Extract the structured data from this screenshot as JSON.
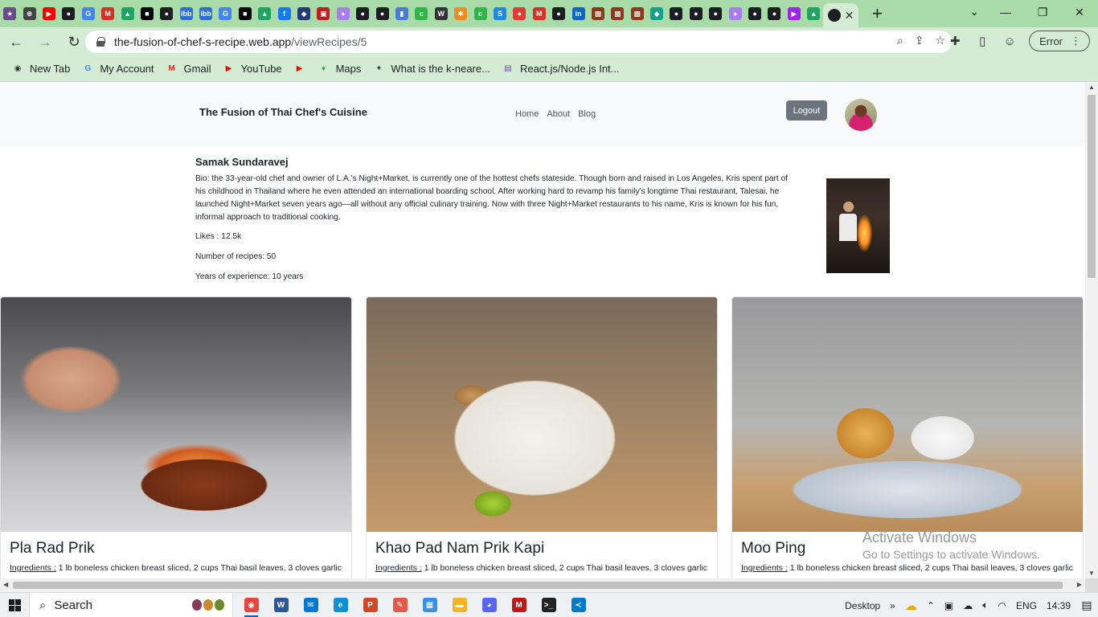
{
  "browser": {
    "tab_favicons": [
      {
        "name": "site-icon",
        "color": "#6b4c8a",
        "glyph": "★"
      },
      {
        "name": "openai-icon",
        "color": "#444",
        "glyph": "⊛"
      },
      {
        "name": "youtube-icon",
        "color": "#ff0000",
        "glyph": "▶"
      },
      {
        "name": "github-icon",
        "color": "#1b1f23",
        "glyph": "●"
      },
      {
        "name": "google-icon",
        "color": "#4285f4",
        "glyph": "G"
      },
      {
        "name": "gmail-icon",
        "color": "#d93025",
        "glyph": "M"
      },
      {
        "name": "drive-icon",
        "color": "#1fa463",
        "glyph": "▲"
      },
      {
        "name": "app-icon",
        "color": "#000",
        "glyph": "■"
      },
      {
        "name": "github-icon",
        "color": "#1b1f23",
        "glyph": "●"
      },
      {
        "name": "ibb-icon",
        "color": "#2a6ed8",
        "glyph": "ibb"
      },
      {
        "name": "ibb-icon",
        "color": "#2a6ed8",
        "glyph": "ibb"
      },
      {
        "name": "google-icon",
        "color": "#4285f4",
        "glyph": "G"
      },
      {
        "name": "app-icon",
        "color": "#000",
        "glyph": "■"
      },
      {
        "name": "drive-icon",
        "color": "#1fa463",
        "glyph": "▲"
      },
      {
        "name": "facebook-icon",
        "color": "#1877f2",
        "glyph": "f"
      },
      {
        "name": "site-icon",
        "color": "#223a7a",
        "glyph": "◆"
      },
      {
        "name": "site-icon",
        "color": "#c01e1e",
        "glyph": "▣"
      },
      {
        "name": "site-icon",
        "color": "#a97cf0",
        "glyph": "♦"
      },
      {
        "name": "github-icon",
        "color": "#1b1f23",
        "glyph": "●"
      },
      {
        "name": "github-icon",
        "color": "#1b1f23",
        "glyph": "●"
      },
      {
        "name": "site-icon",
        "color": "#4a7bd6",
        "glyph": "▮"
      },
      {
        "name": "site-icon",
        "color": "#2fb54a",
        "glyph": "c"
      },
      {
        "name": "site-icon",
        "color": "#333",
        "glyph": "W"
      },
      {
        "name": "site-icon",
        "color": "#f08a24",
        "glyph": "✱"
      },
      {
        "name": "site-icon",
        "color": "#2fb54a",
        "glyph": "c"
      },
      {
        "name": "site-icon",
        "color": "#1e88e5",
        "glyph": "S"
      },
      {
        "name": "site-icon",
        "color": "#e53935",
        "glyph": "●"
      },
      {
        "name": "gmail-icon",
        "color": "#d93025",
        "glyph": "M"
      },
      {
        "name": "github-icon",
        "color": "#1b1f23",
        "glyph": "●"
      },
      {
        "name": "linkedin-icon",
        "color": "#0a66c2",
        "glyph": "in"
      },
      {
        "name": "site-icon",
        "color": "#8b3a1a",
        "glyph": "▩"
      },
      {
        "name": "site-icon",
        "color": "#8b3a1a",
        "glyph": "▩"
      },
      {
        "name": "site-icon",
        "color": "#8b3a1a",
        "glyph": "▩"
      },
      {
        "name": "site-icon",
        "color": "#14a28c",
        "glyph": "◆"
      },
      {
        "name": "github-icon",
        "color": "#1b1f23",
        "glyph": "●"
      },
      {
        "name": "github-icon",
        "color": "#1b1f23",
        "glyph": "●"
      },
      {
        "name": "github-icon",
        "color": "#1b1f23",
        "glyph": "●"
      },
      {
        "name": "site-icon",
        "color": "#a97cf0",
        "glyph": "♦"
      },
      {
        "name": "github-icon",
        "color": "#1b1f23",
        "glyph": "●"
      },
      {
        "name": "github-icon",
        "color": "#1b1f23",
        "glyph": "●"
      },
      {
        "name": "site-icon",
        "color": "#a020f0",
        "glyph": "▶"
      },
      {
        "name": "drive-icon",
        "color": "#1fa463",
        "glyph": "▲"
      }
    ],
    "url_host": "the-fusion-of-chef-s-recipe.web.app",
    "url_path": "/viewRecipes/5",
    "profile_status": "Error",
    "bookmarks": [
      {
        "label": "New Tab",
        "icon": "globe-icon",
        "color": "#333",
        "glyph": "◉"
      },
      {
        "label": "My Account",
        "icon": "google-icon",
        "color": "#4285f4",
        "glyph": "G"
      },
      {
        "label": "Gmail",
        "icon": "gmail-icon",
        "color": "#d93025",
        "glyph": "M"
      },
      {
        "label": "YouTube",
        "icon": "youtube-icon",
        "color": "#ff0000",
        "glyph": "▶"
      },
      {
        "label": "",
        "icon": "youtube-icon",
        "color": "#ff0000",
        "glyph": "▶"
      },
      {
        "label": "Maps",
        "icon": "maps-icon",
        "color": "#34a853",
        "glyph": "♦"
      },
      {
        "label": "What is the k-neare...",
        "icon": "site-icon",
        "color": "#444",
        "glyph": "✦"
      },
      {
        "label": "React.js/Node.js Int...",
        "icon": "site-icon",
        "color": "#6b4bb5",
        "glyph": "▤"
      }
    ]
  },
  "site": {
    "brand": "The Fusion of Thai Chef's Cuisine",
    "nav": [
      "Home",
      "About",
      "Blog"
    ],
    "logout_label": "Logout"
  },
  "chef": {
    "name": "Samak Sundaravej",
    "bio": "Bio: the 33-year-old chef and owner of L.A.'s Night+Market, is currently one of the hottest chefs stateside. Though born and raised in Los Angeles, Kris spent part of his childhood in Thailand where he even attended an international boarding school. After working hard to revamp his family's longtime Thai restaurant, Talesai, he launched Night+Market seven years ago—all without any official culinary training. Now with three Night+Market restaurants to his name, Kris is known for his fun, informal approach to traditional cooking.",
    "likes": "Likes : 12.5k",
    "recipes": "Number of recipes: 50",
    "experience": "Years of experience: 10 years"
  },
  "recipes": [
    {
      "title": "Pla Rad Prik",
      "ingredients_label": "Ingredients :",
      "ingredients": " 1 lb boneless chicken breast sliced, 2 cups Thai basil leaves, 3 cloves garlic,"
    },
    {
      "title": "Khao Pad Nam Prik Kapi",
      "ingredients_label": "Ingredients :",
      "ingredients": " 1 lb boneless chicken breast sliced, 2 cups Thai basil leaves, 3 cloves garlic,"
    },
    {
      "title": "Moo Ping",
      "ingredients_label": "Ingredients :",
      "ingredients": " 1 lb boneless chicken breast sliced, 2 cups Thai basil leaves, 3 cloves garlic,"
    }
  ],
  "watermark": {
    "line1": "Activate Windows",
    "line2": "Go to Settings to activate Windows."
  },
  "taskbar": {
    "search_label": "Search",
    "apps": [
      {
        "name": "chrome-icon",
        "color": "#e8453c",
        "glyph": "◉",
        "active": true
      },
      {
        "name": "word-icon",
        "color": "#2b579a",
        "glyph": "W",
        "active": false
      },
      {
        "name": "mail-icon",
        "color": "#0078d4",
        "glyph": "✉",
        "active": false
      },
      {
        "name": "edge-icon",
        "color": "#0c8fd6",
        "glyph": "e",
        "active": false
      },
      {
        "name": "powerpoint-icon",
        "color": "#d24726",
        "glyph": "P",
        "active": false
      },
      {
        "name": "paint-icon",
        "color": "#e05a4a",
        "glyph": "✎",
        "active": false
      },
      {
        "name": "store-icon",
        "color": "#3a8ee6",
        "glyph": "▦",
        "active": false
      },
      {
        "name": "explorer-icon",
        "color": "#f0b429",
        "glyph": "▬",
        "active": false
      },
      {
        "name": "discord-icon",
        "color": "#5865f2",
        "glyph": "◕",
        "active": false
      },
      {
        "name": "mcafee-icon",
        "color": "#c01818",
        "glyph": "M",
        "active": false
      },
      {
        "name": "terminal-icon",
        "color": "#222",
        "glyph": ">_",
        "active": false
      },
      {
        "name": "vscode-icon",
        "color": "#007acc",
        "glyph": "≺",
        "active": false
      }
    ],
    "desktop_label": "Desktop",
    "language": "ENG",
    "time": "14:39"
  }
}
